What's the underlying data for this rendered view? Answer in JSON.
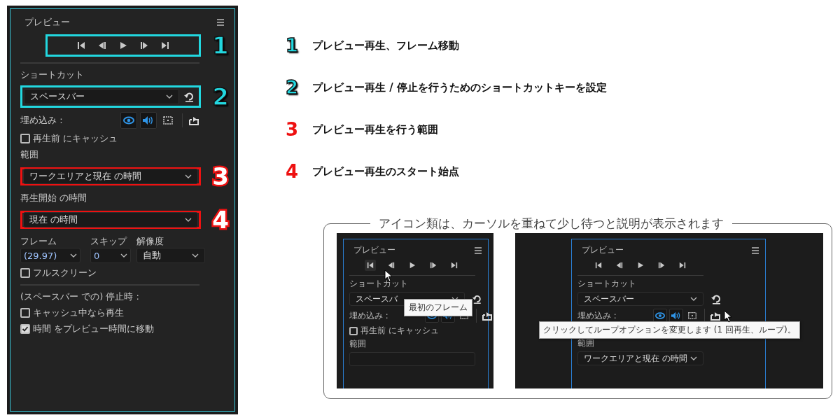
{
  "panel": {
    "title": "プレビュー",
    "transport_callout": {
      "number": "1",
      "color": "#22d8e0",
      "kind": "filled"
    },
    "shortcut_label": "ショートカット",
    "shortcut": {
      "value": "スペースバー",
      "callout": {
        "number": "2",
        "color": "#22d8e0",
        "kind": "filled"
      }
    },
    "embed_label": "埋め込み :",
    "embed_toggles": [
      {
        "kind": "video",
        "on": true
      },
      {
        "kind": "audio",
        "on": true
      },
      {
        "kind": "overlay",
        "on": false
      }
    ],
    "cache_before": {
      "label": "再生前 にキャッシュ",
      "checked": false
    },
    "range": {
      "label": "範囲",
      "value": "ワークエリアと現在 の時間",
      "callout": {
        "number": "3",
        "color": "#ee1111",
        "kind": "outlined"
      }
    },
    "start": {
      "label": "再生開始 の時間",
      "value": "現在 の時間",
      "callout": {
        "number": "4",
        "color": "#ee1111",
        "kind": "outlined"
      }
    },
    "frame": {
      "label": "フレーム",
      "value": "(29.97)"
    },
    "skip": {
      "label": "スキップ",
      "value": "0"
    },
    "resolution": {
      "label": "解像度",
      "value": "自動"
    },
    "fullscreen": {
      "label": "フルスクリーン",
      "checked": false
    },
    "stop_heading": "(スペースバー での) 停止時 :",
    "stop_options": [
      {
        "label": "キャッシュ中なら再生",
        "checked": false
      },
      {
        "label": "時間 をプレビュー時間に移動",
        "checked": true
      }
    ]
  },
  "annotations": [
    {
      "number": "1",
      "color": "#22d8e0",
      "kind": "filled",
      "text": "プレビュー再生、フレーム移動"
    },
    {
      "number": "2",
      "color": "#22d8e0",
      "kind": "filled",
      "text": "プレビュー再生 / 停止を行うためのショートカットキーを設定"
    },
    {
      "number": "3",
      "color": "#ee1111",
      "kind": "outlined",
      "text": "プレビュー再生を行う範囲"
    },
    {
      "number": "4",
      "color": "#ee1111",
      "kind": "outlined",
      "text": "プレビュー再生のスタート始点"
    }
  ],
  "hint": {
    "title": "アイコン類は、カーソルを重ねて少し待つと説明が表示されます",
    "examples": [
      {
        "title": "プレビュー",
        "shortcut_label": "ショートカット",
        "shortcut_value": "スペースバ",
        "embed_label": "埋め込み :",
        "cache_label": "再生前 にキャッシュ",
        "cache_checked": false,
        "range_label": "範囲",
        "tooltip": {
          "text": "最初のフレーム",
          "kind": "first-frame"
        }
      },
      {
        "title": "プレビュー",
        "shortcut_label": "ショートカット",
        "shortcut_value": "スペースバー",
        "embed_label": "埋め込み :",
        "range_label": "範囲",
        "range_value": "ワークエリアと現在 の時間",
        "tooltip": {
          "text": "クリックしてループオプションを変更します (1 回再生、ループ)。",
          "kind": "loop"
        }
      }
    ]
  }
}
